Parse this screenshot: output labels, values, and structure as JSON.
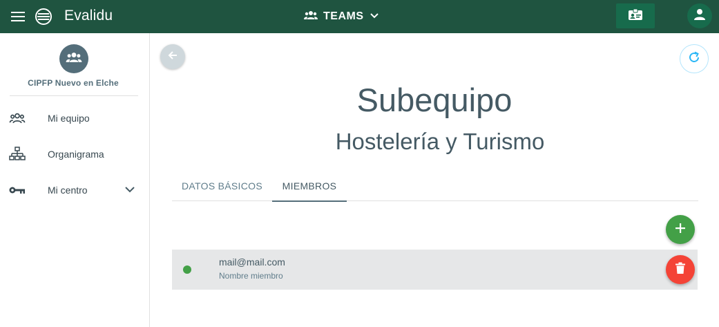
{
  "header": {
    "app_title": "Evalidu",
    "teams_label": "TEAMS",
    "icons": {
      "menu": "menu-icon",
      "logo": "globe-icon",
      "teams": "group-icon",
      "dropdown": "chevron-down-icon",
      "card": "badge-card-icon",
      "account": "account-icon"
    }
  },
  "sidebar": {
    "org_name": "CIPFP Nuevo en Elche",
    "items": [
      {
        "label": "Mi equipo",
        "icon": "group-icon"
      },
      {
        "label": "Organigrama",
        "icon": "org-chart-icon"
      },
      {
        "label": "Mi centro",
        "icon": "key-icon",
        "expandable": true
      }
    ]
  },
  "main": {
    "title": "Subequipo",
    "subtitle": "Hostelería y Turismo",
    "tabs": [
      {
        "label": "DATOS BÁSICOS",
        "active": false
      },
      {
        "label": "MIEMBROS",
        "active": true
      }
    ],
    "members": [
      {
        "email": "mail@mail.com",
        "name": "Nombre miembro",
        "status": "active"
      }
    ]
  },
  "colors": {
    "topbar": "#1f5440",
    "topbar_button": "#176b4c",
    "text_primary": "#455a64",
    "add_button": "#43a047",
    "delete_button": "#f44336",
    "status_active": "#43a047",
    "row_background": "#e6e7e8"
  }
}
